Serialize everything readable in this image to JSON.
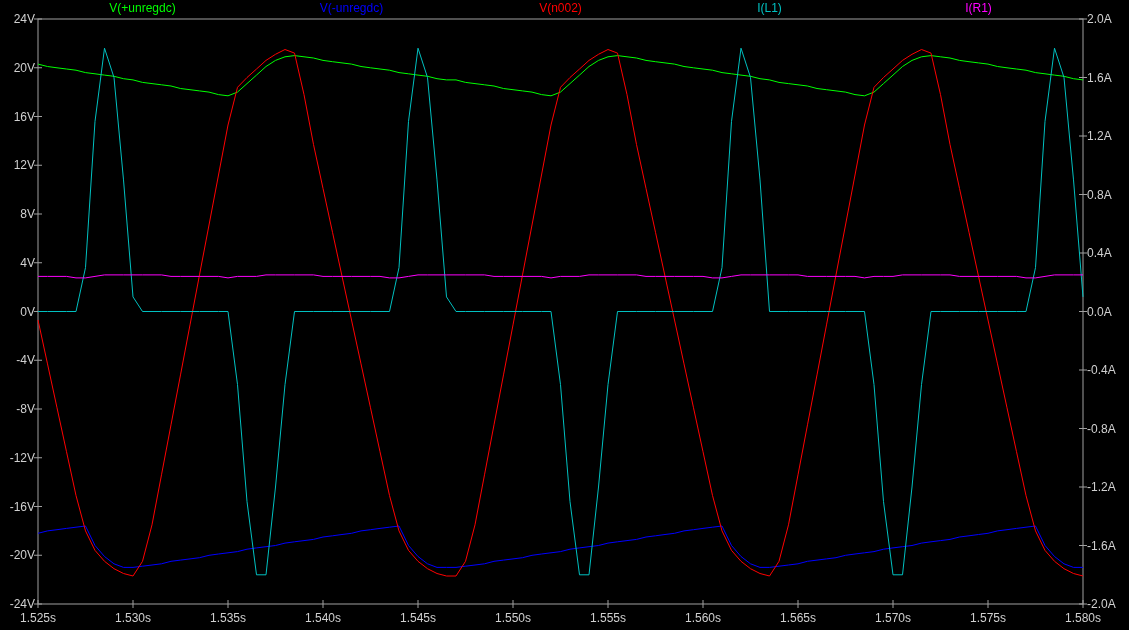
{
  "plot": {
    "chart_data": {
      "type": "line",
      "x": [
        1.525,
        1.5255,
        1.526,
        1.5265,
        1.527,
        1.5275,
        1.528,
        1.5285,
        1.529,
        1.5295,
        1.53,
        1.5305,
        1.531,
        1.5315,
        1.532,
        1.5325,
        1.533,
        1.5335,
        1.534,
        1.5345,
        1.535,
        1.5355,
        1.536,
        1.5365,
        1.537,
        1.5375,
        1.538,
        1.5385,
        1.539,
        1.5395,
        1.54,
        1.5405,
        1.541,
        1.5415,
        1.542,
        1.5425,
        1.543,
        1.5435,
        1.544,
        1.5445,
        1.545,
        1.5455,
        1.546,
        1.5465,
        1.547,
        1.5475,
        1.548,
        1.5485,
        1.549,
        1.5495,
        1.55,
        1.5505,
        1.551,
        1.5515,
        1.552,
        1.5525,
        1.553,
        1.5535,
        1.554,
        1.5545,
        1.555,
        1.5555,
        1.556,
        1.5565,
        1.557,
        1.5575,
        1.558,
        1.5585,
        1.559,
        1.5595,
        1.56,
        1.5605,
        1.561,
        1.5615,
        1.562,
        1.5625,
        1.563,
        1.5635,
        1.564,
        1.5645,
        1.565,
        1.5655,
        1.566,
        1.5665,
        1.567,
        1.5675,
        1.568,
        1.5685,
        1.569,
        1.5695,
        1.57,
        1.5705,
        1.571,
        1.5715,
        1.572,
        1.5725,
        1.573,
        1.5735,
        1.574,
        1.5745,
        1.575,
        1.5755,
        1.576,
        1.5765,
        1.577,
        1.5775,
        1.578,
        1.5785,
        1.579,
        1.5795,
        1.58
      ],
      "series": [
        {
          "name": "V(+unregdc)",
          "color": "#00ff00",
          "values": [
            20.3,
            20.1,
            20.0,
            19.9,
            19.8,
            19.6,
            19.5,
            19.4,
            19.3,
            19.1,
            19.0,
            18.8,
            18.7,
            18.6,
            18.5,
            18.3,
            18.2,
            18.1,
            18.0,
            17.8,
            17.7,
            18.0,
            18.7,
            19.4,
            20.1,
            20.6,
            20.9,
            21.0,
            20.9,
            20.8,
            20.6,
            20.5,
            20.4,
            20.3,
            20.1,
            20.0,
            19.9,
            19.8,
            19.6,
            19.5,
            19.4,
            19.3,
            19.1,
            19.0,
            19.0,
            18.8,
            18.7,
            18.6,
            18.5,
            18.3,
            18.2,
            18.1,
            18.0,
            17.8,
            17.7,
            18.0,
            18.7,
            19.4,
            20.1,
            20.6,
            20.9,
            21.0,
            20.9,
            20.8,
            20.6,
            20.5,
            20.4,
            20.3,
            20.1,
            20.0,
            19.9,
            19.8,
            19.6,
            19.5,
            19.4,
            19.3,
            19.1,
            19.0,
            18.8,
            18.7,
            18.6,
            18.5,
            18.3,
            18.2,
            18.1,
            18.0,
            17.8,
            17.7,
            18.0,
            18.7,
            19.4,
            20.1,
            20.6,
            20.9,
            21.0,
            20.9,
            20.8,
            20.6,
            20.5,
            20.4,
            20.3,
            20.1,
            20.0,
            19.9,
            19.8,
            19.6,
            19.5,
            19.4,
            19.3,
            19.1,
            19.0
          ]
        },
        {
          "name": "V(-unregdc)",
          "color": "#0000ff",
          "values": [
            -18.2,
            -18.0,
            -17.9,
            -17.8,
            -17.7,
            -17.6,
            -19.2,
            -20.1,
            -20.7,
            -21.0,
            -21.0,
            -20.9,
            -20.8,
            -20.7,
            -20.5,
            -20.4,
            -20.3,
            -20.2,
            -20.0,
            -19.9,
            -19.8,
            -19.7,
            -19.5,
            -19.4,
            -19.3,
            -19.2,
            -19.0,
            -18.9,
            -18.8,
            -18.7,
            -18.5,
            -18.4,
            -18.3,
            -18.2,
            -18.0,
            -17.9,
            -17.8,
            -17.7,
            -17.6,
            -19.2,
            -20.1,
            -20.7,
            -21.0,
            -21.0,
            -21.0,
            -20.9,
            -20.8,
            -20.7,
            -20.5,
            -20.4,
            -20.3,
            -20.2,
            -20.0,
            -19.9,
            -19.8,
            -19.7,
            -19.5,
            -19.4,
            -19.3,
            -19.2,
            -19.0,
            -18.9,
            -18.8,
            -18.7,
            -18.5,
            -18.4,
            -18.3,
            -18.2,
            -18.0,
            -17.9,
            -17.8,
            -17.7,
            -17.6,
            -19.2,
            -20.1,
            -20.7,
            -21.0,
            -21.0,
            -20.9,
            -20.8,
            -20.7,
            -20.5,
            -20.4,
            -20.3,
            -20.2,
            -20.0,
            -19.9,
            -19.8,
            -19.7,
            -19.5,
            -19.4,
            -19.3,
            -19.2,
            -19.0,
            -18.9,
            -18.8,
            -18.7,
            -18.5,
            -18.4,
            -18.3,
            -18.2,
            -18.0,
            -17.9,
            -17.8,
            -17.7,
            -17.6,
            -19.2,
            -20.1,
            -20.7,
            -21.0,
            -21.0
          ]
        },
        {
          "name": "V(n002)",
          "color": "#ff0000",
          "values": [
            -0.7,
            -4.3,
            -7.9,
            -11.5,
            -15.1,
            -18.0,
            -19.6,
            -20.5,
            -21.1,
            -21.5,
            -21.7,
            -20.5,
            -17.5,
            -13.4,
            -9.3,
            -5.2,
            -1.1,
            3.0,
            7.1,
            11.2,
            15.3,
            18.4,
            19.2,
            19.9,
            20.6,
            21.1,
            21.5,
            21.2,
            17.8,
            13.7,
            10.1,
            6.5,
            2.9,
            -0.7,
            -4.3,
            -7.9,
            -11.5,
            -15.1,
            -18.0,
            -19.6,
            -20.5,
            -21.1,
            -21.5,
            -21.7,
            -21.7,
            -20.5,
            -17.5,
            -13.4,
            -9.3,
            -5.2,
            -1.1,
            3.0,
            7.1,
            11.2,
            15.3,
            18.4,
            19.2,
            19.9,
            20.6,
            21.1,
            21.5,
            21.2,
            17.8,
            13.7,
            10.1,
            6.5,
            2.9,
            -0.7,
            -4.3,
            -7.9,
            -11.5,
            -15.1,
            -18.0,
            -19.6,
            -20.5,
            -21.1,
            -21.5,
            -21.7,
            -20.5,
            -17.5,
            -13.4,
            -9.3,
            -5.2,
            -1.1,
            3.0,
            7.1,
            11.2,
            15.3,
            18.4,
            19.2,
            19.9,
            20.6,
            21.1,
            21.5,
            21.2,
            17.8,
            13.7,
            10.1,
            6.5,
            2.9,
            -0.7,
            -4.3,
            -7.9,
            -11.5,
            -15.1,
            -18.0,
            -19.6,
            -20.5,
            -21.1,
            -21.5,
            -21.7
          ]
        },
        {
          "name": "I(L1)",
          "color": "#00c0c0",
          "axis": "y2",
          "values": [
            0,
            0,
            0,
            0,
            0,
            0.3,
            1.3,
            1.8,
            1.6,
            0.9,
            0.1,
            0,
            0,
            0,
            0,
            0,
            0,
            0,
            0,
            0,
            0,
            -0.5,
            -1.3,
            -1.8,
            -1.8,
            -1.2,
            -0.5,
            0,
            0,
            0,
            0,
            0,
            0,
            0,
            0,
            0,
            0,
            0,
            0.3,
            1.3,
            1.8,
            1.6,
            0.9,
            0.1,
            0,
            0,
            0,
            0,
            0,
            0,
            0,
            0,
            0,
            0,
            0,
            -0.5,
            -1.3,
            -1.8,
            -1.8,
            -1.2,
            -0.5,
            0,
            0,
            0,
            0,
            0,
            0,
            0,
            0,
            0,
            0,
            0,
            0.3,
            1.3,
            1.8,
            1.6,
            0.9,
            0,
            0,
            0,
            0,
            0,
            0,
            0,
            0,
            0,
            0,
            0,
            -0.5,
            -1.3,
            -1.8,
            -1.8,
            -1.2,
            -0.5,
            0,
            0,
            0,
            0,
            0,
            0,
            0,
            0,
            0,
            0,
            0,
            0.3,
            1.3,
            1.8,
            1.6,
            0.9,
            0.1
          ]
        },
        {
          "name": "I(R1)",
          "color": "#ff00ff",
          "axis": "y2",
          "values": [
            0.24,
            0.24,
            0.24,
            0.24,
            0.23,
            0.23,
            0.24,
            0.25,
            0.25,
            0.25,
            0.25,
            0.25,
            0.25,
            0.25,
            0.24,
            0.24,
            0.24,
            0.24,
            0.24,
            0.24,
            0.23,
            0.24,
            0.24,
            0.24,
            0.25,
            0.25,
            0.25,
            0.25,
            0.25,
            0.25,
            0.24,
            0.24,
            0.24,
            0.24,
            0.24,
            0.24,
            0.24,
            0.23,
            0.23,
            0.24,
            0.25,
            0.25,
            0.25,
            0.25,
            0.25,
            0.25,
            0.25,
            0.25,
            0.24,
            0.24,
            0.24,
            0.24,
            0.24,
            0.24,
            0.23,
            0.24,
            0.24,
            0.24,
            0.25,
            0.25,
            0.25,
            0.25,
            0.25,
            0.25,
            0.24,
            0.24,
            0.24,
            0.24,
            0.24,
            0.24,
            0.24,
            0.23,
            0.23,
            0.24,
            0.25,
            0.25,
            0.25,
            0.25,
            0.25,
            0.25,
            0.25,
            0.24,
            0.24,
            0.24,
            0.24,
            0.24,
            0.24,
            0.23,
            0.24,
            0.24,
            0.24,
            0.25,
            0.25,
            0.25,
            0.25,
            0.25,
            0.25,
            0.24,
            0.24,
            0.24,
            0.24,
            0.24,
            0.24,
            0.24,
            0.23,
            0.23,
            0.24,
            0.25,
            0.25,
            0.25,
            0.25
          ]
        }
      ],
      "xlim": [
        1.525,
        1.58
      ],
      "xticks": [
        {
          "value": 1.525,
          "label": "1.525s"
        },
        {
          "value": 1.53,
          "label": "1.530s"
        },
        {
          "value": 1.535,
          "label": "1.535s"
        },
        {
          "value": 1.54,
          "label": "1.540s"
        },
        {
          "value": 1.545,
          "label": "1.545s"
        },
        {
          "value": 1.55,
          "label": "1.550s"
        },
        {
          "value": 1.555,
          "label": "1.555s"
        },
        {
          "value": 1.56,
          "label": "1.560s"
        },
        {
          "value": 1.565,
          "label": "1.565s"
        },
        {
          "value": 1.57,
          "label": "1.570s"
        },
        {
          "value": 1.575,
          "label": "1.575s"
        },
        {
          "value": 1.58,
          "label": "1.580s"
        }
      ],
      "ylim": [
        -24,
        24
      ],
      "yticks": [
        {
          "value": 24,
          "label": "24V"
        },
        {
          "value": 20,
          "label": "20V"
        },
        {
          "value": 16,
          "label": "16V"
        },
        {
          "value": 12,
          "label": "12V"
        },
        {
          "value": 8,
          "label": "8V"
        },
        {
          "value": 4,
          "label": "4V"
        },
        {
          "value": 0,
          "label": "0V"
        },
        {
          "value": -4,
          "label": "-4V"
        },
        {
          "value": -8,
          "label": "-8V"
        },
        {
          "value": -12,
          "label": "-12V"
        },
        {
          "value": -16,
          "label": "-16V"
        },
        {
          "value": -20,
          "label": "-20V"
        },
        {
          "value": -24,
          "label": "-24V"
        }
      ],
      "y2lim": [
        -2,
        2
      ],
      "y2ticks": [
        {
          "value": 2,
          "label": "2.0A"
        },
        {
          "value": 1.6,
          "label": "1.6A"
        },
        {
          "value": 1.2,
          "label": "1.2A"
        },
        {
          "value": 0.8,
          "label": "0.8A"
        },
        {
          "value": 0.4,
          "label": "0.4A"
        },
        {
          "value": 0,
          "label": "0.0A"
        },
        {
          "value": -0.4,
          "label": "-0.4A"
        },
        {
          "value": -0.8,
          "label": "-0.8A"
        },
        {
          "value": -1.2,
          "label": "-1.2A"
        },
        {
          "value": -1.6,
          "label": "-1.6A"
        },
        {
          "value": -2,
          "label": "-2.0A"
        }
      ]
    }
  }
}
